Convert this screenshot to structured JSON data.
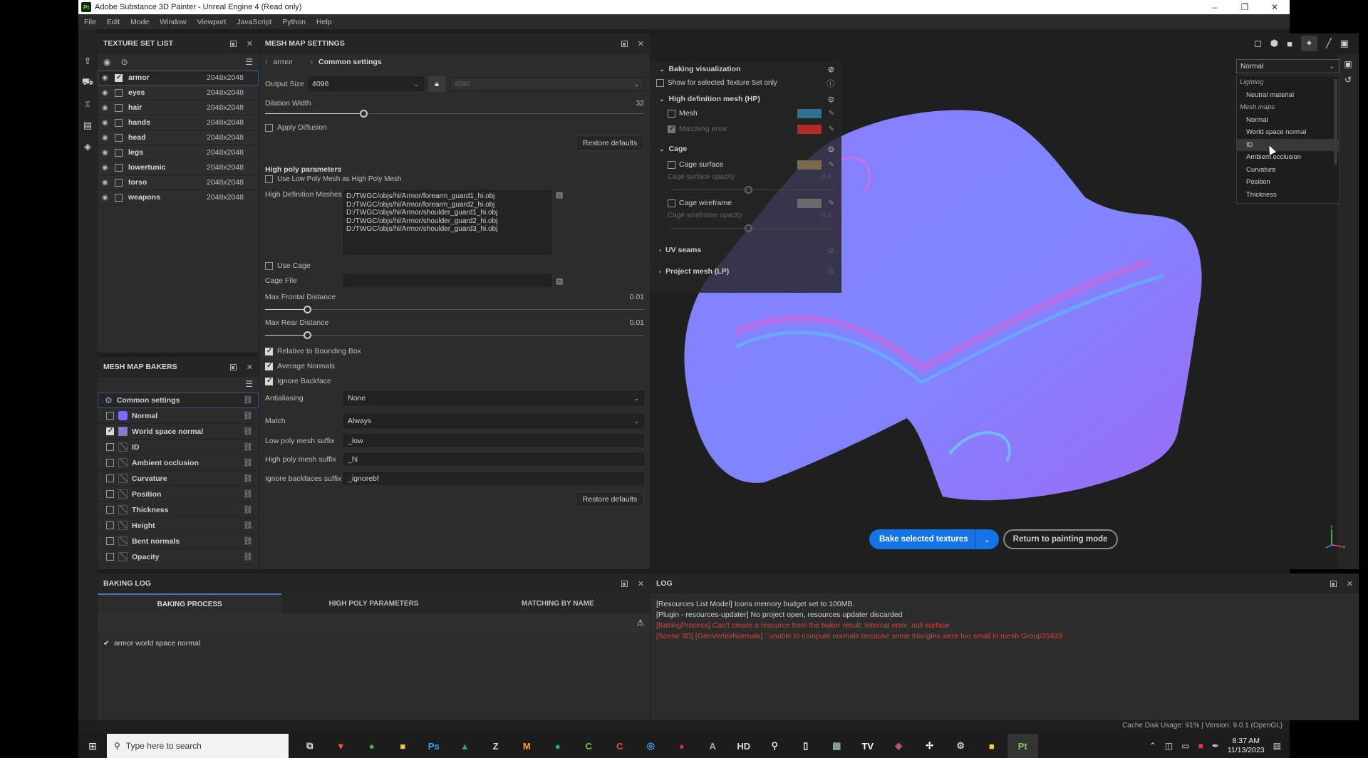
{
  "window": {
    "title": "Adobe Substance 3D Painter - Unreal Engine 4 (Read only)",
    "app_badge": "Pt",
    "controls": [
      "–",
      "❐",
      "✕"
    ]
  },
  "menu": [
    "File",
    "Edit",
    "Mode",
    "Window",
    "Viewport",
    "JavaScript",
    "Python",
    "Help"
  ],
  "texture_set_list": {
    "title": "TEXTURE SET LIST",
    "items": [
      {
        "name": "armor",
        "resolution": "2048x2048",
        "checked": true,
        "selected": true
      },
      {
        "name": "eyes",
        "resolution": "2048x2048",
        "checked": false
      },
      {
        "name": "hair",
        "resolution": "2048x2048",
        "checked": false
      },
      {
        "name": "hands",
        "resolution": "2048x2048",
        "checked": false
      },
      {
        "name": "head",
        "resolution": "2048x2048",
        "checked": false
      },
      {
        "name": "legs",
        "resolution": "2048x2048",
        "checked": false
      },
      {
        "name": "lowertunic",
        "resolution": "2048x2048",
        "checked": false
      },
      {
        "name": "torso",
        "resolution": "2048x2048",
        "checked": false
      },
      {
        "name": "weapons",
        "resolution": "2048x2048",
        "checked": false
      }
    ]
  },
  "mesh_map_bakers": {
    "title": "MESH MAP BAKERS",
    "common": "Common settings",
    "items": [
      {
        "label": "Normal",
        "checked": false,
        "icon": "normal"
      },
      {
        "label": "World space normal",
        "checked": true,
        "icon": "wsn"
      },
      {
        "label": "ID",
        "checked": false
      },
      {
        "label": "Ambient occlusion",
        "checked": false
      },
      {
        "label": "Curvature",
        "checked": false
      },
      {
        "label": "Position",
        "checked": false
      },
      {
        "label": "Thickness",
        "checked": false
      },
      {
        "label": "Height",
        "checked": false
      },
      {
        "label": "Bent normals",
        "checked": false
      },
      {
        "label": "Opacity",
        "checked": false
      }
    ]
  },
  "mesh_map_settings": {
    "title": "MESH MAP SETTINGS",
    "breadcrumb": [
      "armor",
      "Common settings"
    ],
    "output_size_label": "Output Size",
    "output_size": "4096",
    "output_size_linked": "4096",
    "dilation_label": "Dilation Width",
    "dilation_value": "32",
    "dilation_fraction": 0.26,
    "apply_diffusion": "Apply Diffusion",
    "restore_defaults": "Restore defaults",
    "high_poly_title": "High poly parameters",
    "use_low_poly": "Use Low Poly Mesh as High Poly Mesh",
    "hd_meshes_label": "High Definition Meshes",
    "hd_meshes": [
      "D:/TWGC/objs/hi/Armor/forearm_guard1_hi.obj",
      "D:/TWGC/objs/hi/Armor/forearm_guard2_hi.obj",
      "D:/TWGC/objs/hi/Armor/shoulder_guard1_hi.obj",
      "D:/TWGC/objs/hi/Armor/shoulder_guard2_hi.obj",
      "D:/TWGC/objs/hi/Armor/shoulder_guard3_hi.obj"
    ],
    "use_cage": "Use Cage",
    "cage_file_label": "Cage File",
    "cage_file": "",
    "max_frontal_label": "Max Frontal Distance",
    "max_frontal": "0.01",
    "max_frontal_fraction": 0.11,
    "max_rear_label": "Max Rear Distance",
    "max_rear": "0.01",
    "max_rear_fraction": 0.11,
    "relative_bbox": "Relative to Bounding Box",
    "average_normals": "Average Normals",
    "ignore_backface": "Ignore Backface",
    "antialiasing_label": "Antialiasing",
    "antialiasing": "None",
    "match_label": "Match",
    "match": "Always",
    "low_suffix_label": "Low poly mesh suffix",
    "low_suffix": "_low",
    "high_suffix_label": "High poly mesh suffix",
    "high_suffix": "_hi",
    "ignore_bf_suffix_label": "Ignore backfaces suffix",
    "ignore_bf_suffix": "_ignorebf"
  },
  "baking_visualization": {
    "title": "Baking visualization",
    "show_selected": "Show for selected Texture Set only",
    "hp_title": "High definition mesh (HP)",
    "mesh": "Mesh",
    "matching_error": "Matching error",
    "cage_title": "Cage",
    "cage_surface": "Cage surface",
    "cage_surface_opacity": "Cage surface opacity",
    "cage_surface_opacity_value": "0.4",
    "cage_wireframe": "Cage wireframe",
    "cage_wireframe_opacity": "Cage wireframe opacity",
    "cage_wireframe_opacity_value": "0.4",
    "uv_seams": "UV seams",
    "project_mesh": "Project mesh (LP)",
    "colors": {
      "mesh": "#2f6f8f",
      "matching_error": "#b02a2a",
      "cage_surface": "#7a6a4e",
      "cage_wireframe": "#6a6a6a"
    }
  },
  "viewport": {
    "display_mode": "Normal",
    "menu": [
      {
        "type": "group",
        "label": "Lighting"
      },
      {
        "type": "item",
        "label": "Neutral material"
      },
      {
        "type": "group",
        "label": "Mesh maps"
      },
      {
        "type": "item",
        "label": "Normal"
      },
      {
        "type": "item",
        "label": "World space normal"
      },
      {
        "type": "item",
        "label": "ID",
        "hover": true
      },
      {
        "type": "item",
        "label": "Ambient occlusion"
      },
      {
        "type": "item",
        "label": "Curvature"
      },
      {
        "type": "item",
        "label": "Position"
      },
      {
        "type": "item",
        "label": "Thickness"
      }
    ],
    "bake_button": "Bake selected textures",
    "return_button": "Return to painting mode",
    "axis_labels": [
      "Y",
      "X"
    ]
  },
  "baking_log": {
    "title": "BAKING LOG",
    "tabs": [
      "BAKING PROCESS",
      "HIGH POLY PARAMETERS",
      "MATCHING BY NAME"
    ],
    "entries": [
      "armor world space normal"
    ]
  },
  "log": {
    "title": "LOG",
    "lines": [
      {
        "level": "info",
        "text": "[Resources List Model] Icons memory budget set to 100MB."
      },
      {
        "level": "info",
        "text": "[Plugin - resources-updater] No project open, resources updater discarded"
      },
      {
        "level": "error",
        "text": "[BakingProcess] Can't create a resource from the baker result: Internal error, null surface"
      },
      {
        "level": "error",
        "text": "[Scene 3D] [GenVertexNormals] : unable to compute normals because some triangles were too small in mesh Group31633"
      }
    ]
  },
  "status": {
    "text": "Cache Disk Usage:   91% | Version: 9.0.1 (OpenGL)"
  },
  "taskbar": {
    "search_placeholder": "Type here to search",
    "apps": [
      {
        "name": "task-view",
        "glyph": "⧉",
        "color": "#ddd"
      },
      {
        "name": "brave",
        "glyph": "▼",
        "color": "#fb542b"
      },
      {
        "name": "chrome",
        "glyph": "●",
        "color": "#4caf50"
      },
      {
        "name": "file-explorer",
        "glyph": "■",
        "color": "#f2c14e"
      },
      {
        "name": "photoshop",
        "glyph": "Ps",
        "color": "#31a8ff"
      },
      {
        "name": "app-green",
        "glyph": "▲",
        "color": "#2aa198"
      },
      {
        "name": "zbrush",
        "glyph": "Z",
        "color": "#ddd"
      },
      {
        "name": "marmoset",
        "glyph": "M",
        "color": "#f5a623"
      },
      {
        "name": "spotify",
        "glyph": "●",
        "color": "#1db954"
      },
      {
        "name": "camtasia-green",
        "glyph": "C",
        "color": "#7bc043"
      },
      {
        "name": "camtasia-red",
        "glyph": "C",
        "color": "#e74c3c"
      },
      {
        "name": "app-blue-circle",
        "glyph": "◎",
        "color": "#3aa0e8"
      },
      {
        "name": "obs",
        "glyph": "●",
        "color": "#c0392b"
      },
      {
        "name": "translator",
        "glyph": "A",
        "color": "#9ab"
      },
      {
        "name": "hd-app",
        "glyph": "HD",
        "color": "#ddd"
      },
      {
        "name": "search-app",
        "glyph": "⚲",
        "color": "#ddd"
      },
      {
        "name": "notepad",
        "glyph": "▯",
        "color": "#fff"
      },
      {
        "name": "calculator",
        "glyph": "▦",
        "color": "#8aa"
      },
      {
        "name": "tradingview",
        "glyph": "TV",
        "color": "#fff"
      },
      {
        "name": "substance-designer",
        "glyph": "◆",
        "color": "#c0506a"
      },
      {
        "name": "fan-app",
        "glyph": "✢",
        "color": "#fff"
      },
      {
        "name": "settings",
        "glyph": "⚙",
        "color": "#ccc"
      },
      {
        "name": "sticky-notes",
        "glyph": "■",
        "color": "#f7d51d"
      },
      {
        "name": "substance-painter",
        "glyph": "Pt",
        "color": "#7fd14a",
        "active": true
      }
    ],
    "time": "8:37 AM",
    "date": "11/13/2023"
  }
}
